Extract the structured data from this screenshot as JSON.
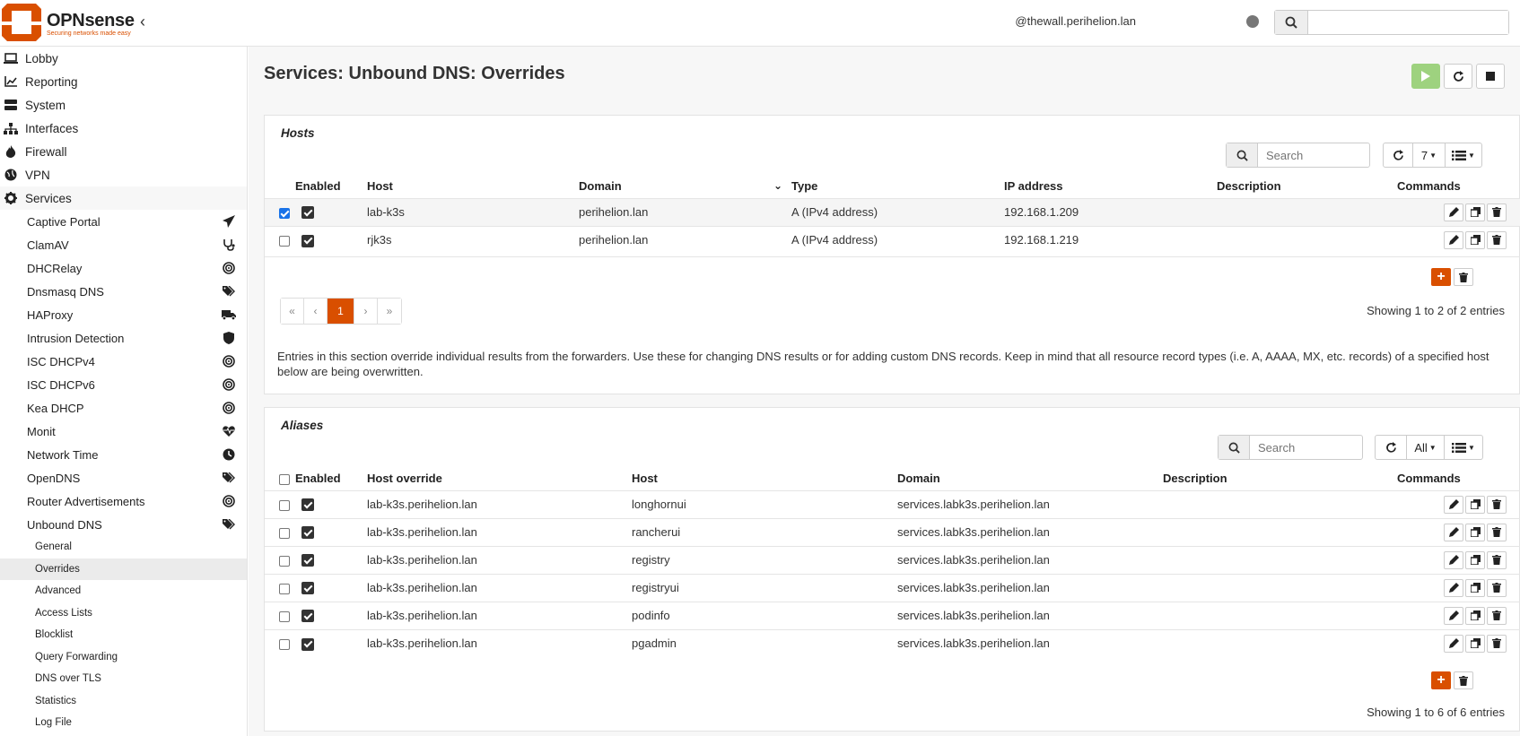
{
  "brand": {
    "name": "OPNsense",
    "tagline": "Securing networks made easy",
    "accent": "#d94f00"
  },
  "header": {
    "user": "@thewall.perihelion.lan",
    "search_placeholder": ""
  },
  "sidebar": {
    "top": [
      {
        "label": "Lobby",
        "icon": "laptop-icon"
      },
      {
        "label": "Reporting",
        "icon": "chart-icon"
      },
      {
        "label": "System",
        "icon": "server-icon"
      },
      {
        "label": "Interfaces",
        "icon": "sitemap-icon"
      },
      {
        "label": "Firewall",
        "icon": "fire-icon"
      },
      {
        "label": "VPN",
        "icon": "globe-icon"
      },
      {
        "label": "Services",
        "icon": "gear-icon"
      }
    ],
    "services": [
      {
        "label": "Captive Portal",
        "icon": "paper-plane-icon"
      },
      {
        "label": "ClamAV",
        "icon": "stethoscope-icon"
      },
      {
        "label": "DHCRelay",
        "icon": "bullseye-icon"
      },
      {
        "label": "Dnsmasq DNS",
        "icon": "tags-icon"
      },
      {
        "label": "HAProxy",
        "icon": "truck-icon"
      },
      {
        "label": "Intrusion Detection",
        "icon": "shield-icon"
      },
      {
        "label": "ISC DHCPv4",
        "icon": "bullseye-icon"
      },
      {
        "label": "ISC DHCPv6",
        "icon": "bullseye-icon"
      },
      {
        "label": "Kea DHCP",
        "icon": "bullseye-icon"
      },
      {
        "label": "Monit",
        "icon": "heartbeat-icon"
      },
      {
        "label": "Network Time",
        "icon": "clock-icon"
      },
      {
        "label": "OpenDNS",
        "icon": "tags-icon"
      },
      {
        "label": "Router Advertisements",
        "icon": "bullseye-icon"
      },
      {
        "label": "Unbound DNS",
        "icon": "tags-icon"
      }
    ],
    "unbound": [
      "General",
      "Overrides",
      "Advanced",
      "Access Lists",
      "Blocklist",
      "Query Forwarding",
      "DNS over TLS",
      "Statistics",
      "Log File"
    ]
  },
  "page": {
    "title": "Services: Unbound DNS: Overrides"
  },
  "hosts": {
    "title": "Hosts",
    "search_placeholder": "Search",
    "page_size": "7",
    "columns": [
      "Enabled",
      "Host",
      "Domain",
      "Type",
      "IP address",
      "Description",
      "Commands"
    ],
    "rows": [
      {
        "selected": true,
        "host": "lab-k3s",
        "domain": "perihelion.lan",
        "type": "A (IPv4 address)",
        "ip": "192.168.1.209",
        "description": ""
      },
      {
        "selected": false,
        "host": "rjk3s",
        "domain": "perihelion.lan",
        "type": "A (IPv4 address)",
        "ip": "192.168.1.219",
        "description": ""
      }
    ],
    "pager": [
      "«",
      "‹",
      "1",
      "›",
      "»"
    ],
    "showing": "Showing 1 to 2 of 2 entries",
    "note": "Entries in this section override individual results from the forwarders. Use these for changing DNS results or for adding custom DNS records. Keep in mind that all resource record types (i.e. A, AAAA, MX, etc. records) of a specified host below are being overwritten."
  },
  "aliases": {
    "title": "Aliases",
    "search_placeholder": "Search",
    "page_size": "All",
    "columns": [
      "Enabled",
      "Host override",
      "Host",
      "Domain",
      "Description",
      "Commands"
    ],
    "rows": [
      {
        "override": "lab-k3s.perihelion.lan",
        "host": "longhornui",
        "domain": "services.labk3s.perihelion.lan",
        "description": ""
      },
      {
        "override": "lab-k3s.perihelion.lan",
        "host": "rancherui",
        "domain": "services.labk3s.perihelion.lan",
        "description": ""
      },
      {
        "override": "lab-k3s.perihelion.lan",
        "host": "registry",
        "domain": "services.labk3s.perihelion.lan",
        "description": ""
      },
      {
        "override": "lab-k3s.perihelion.lan",
        "host": "registryui",
        "domain": "services.labk3s.perihelion.lan",
        "description": ""
      },
      {
        "override": "lab-k3s.perihelion.lan",
        "host": "podinfo",
        "domain": "services.labk3s.perihelion.lan",
        "description": ""
      },
      {
        "override": "lab-k3s.perihelion.lan",
        "host": "pgadmin",
        "domain": "services.labk3s.perihelion.lan",
        "description": ""
      }
    ],
    "showing": "Showing 1 to 6 of 6 entries"
  }
}
